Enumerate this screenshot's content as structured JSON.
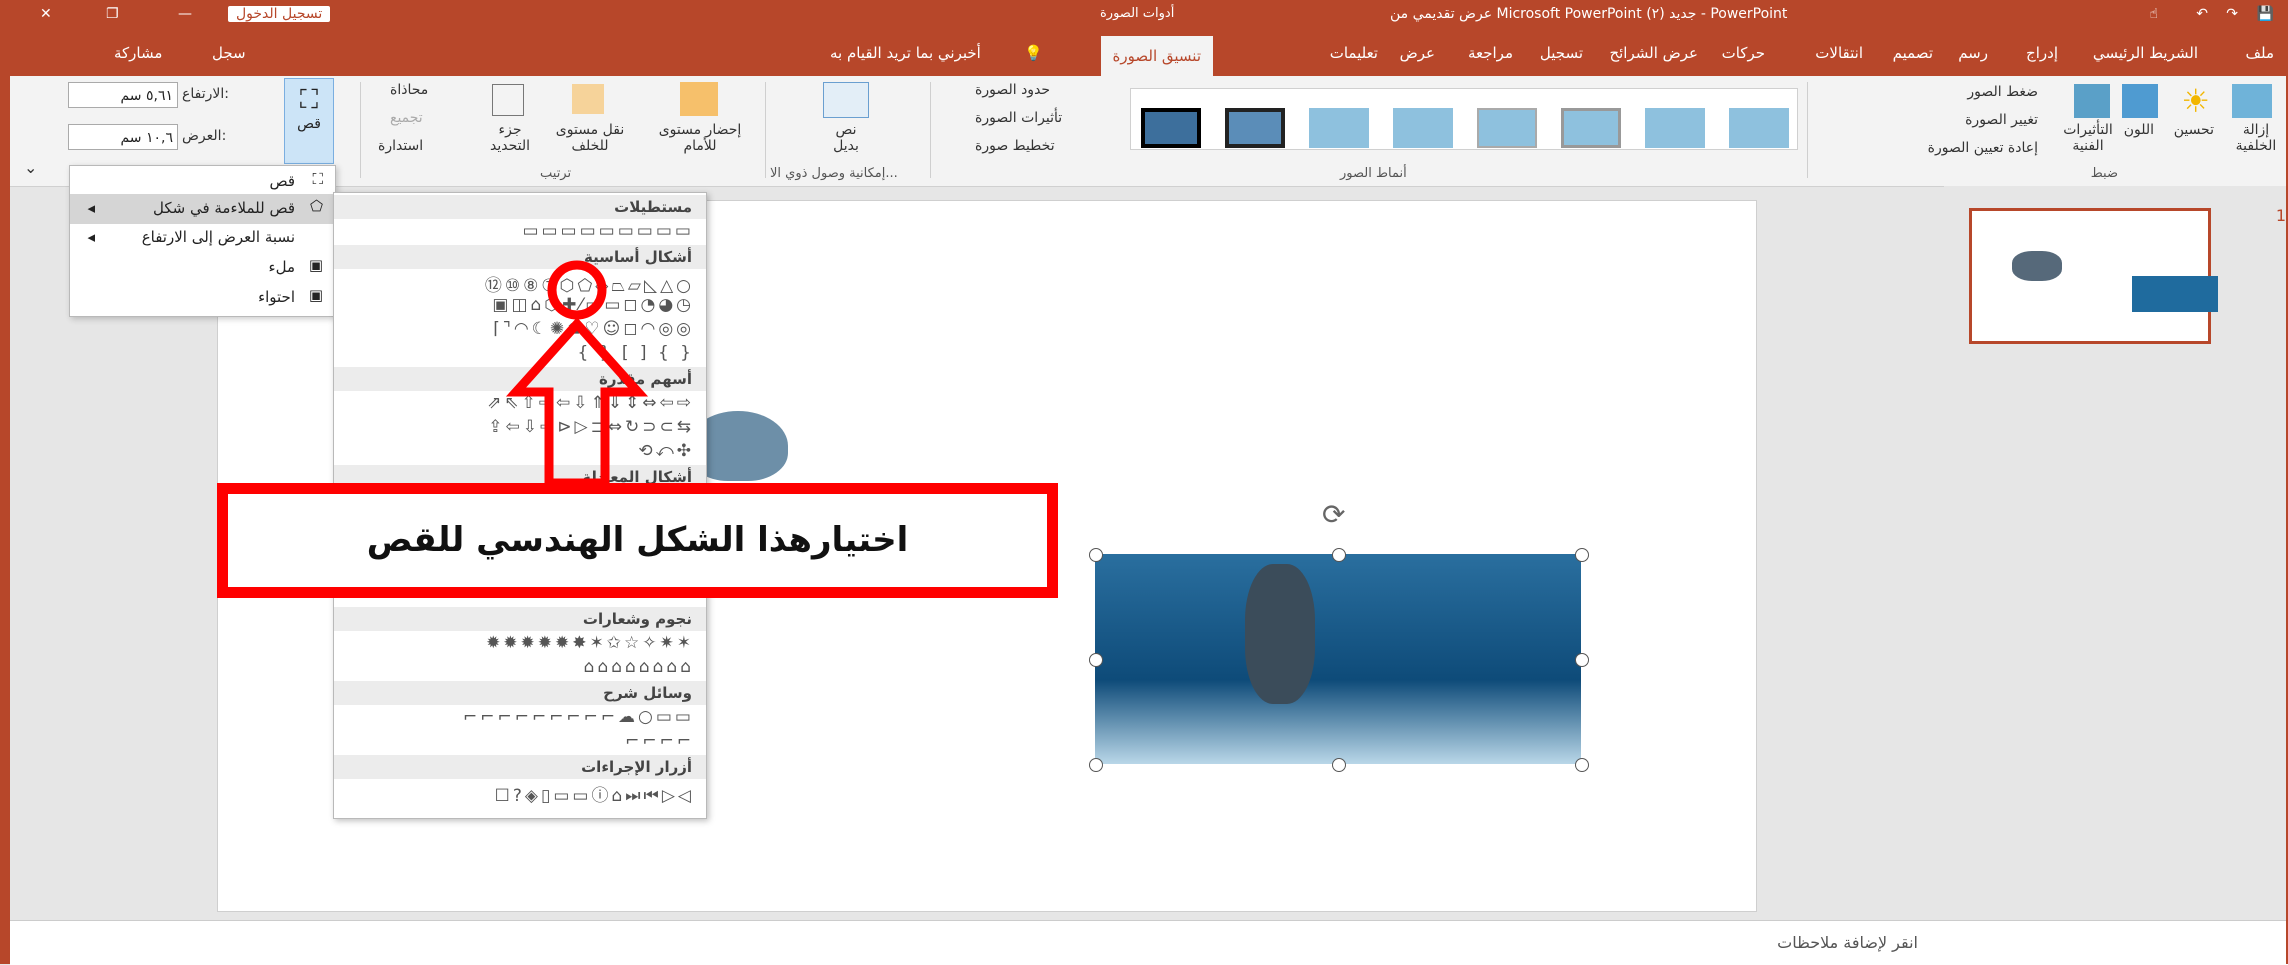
{
  "window": {
    "title": "عرض تقديمي من Microsoft PowerPoint جديد (٢) - PowerPoint",
    "context_tab": "أدوات الصورة",
    "sign_in": "تسجيل الدخول"
  },
  "tabs": [
    "ملف",
    "الشريط الرئيسي",
    "إدراج",
    "رسم",
    "تصميم",
    "انتقالات",
    "حركات",
    "عرض الشرائح",
    "تسجيل",
    "مراجعة",
    "عرض",
    "تعليمات",
    "تنسيق الصورة"
  ],
  "tell_me": "أخبرني بما تريد القيام به",
  "share": "مشاركة",
  "record": "سجل",
  "ribbon": {
    "remove_bg": "إزالة الخلفية",
    "corrections": "تحسين",
    "color": "اللون",
    "artistic": "التأثيرات الفنية",
    "compress": "ضغط الصور",
    "change_pic": "تغيير الصورة",
    "reset_pic": "إعادة تعيين الصورة",
    "adjust_group": "ضبط",
    "styles_group": "أنماط الصور",
    "border": "حدود الصورة",
    "effects": "تأثيرات الصورة",
    "layout": "تخطيط صورة",
    "alt_text": "نص بديل",
    "access_group": "إمكانية وصول ذوي الا...",
    "bring_forward": "إحضار مستوى للأمام",
    "send_backward": "نقل مستوى للخلف",
    "selection_pane": "جزء التحديد",
    "align": "محاذاة",
    "group": "تجميع",
    "rotate": "استدارة",
    "arrange_group": "ترتيب",
    "crop": "قص",
    "height_label": "الارتفاع:",
    "height_value": "٥,٦١ سم",
    "width_label": "العرض:",
    "width_value": "١٠,٦ سم"
  },
  "crop_menu": [
    "قص",
    "قص للملاءمة في شكل",
    "نسبة العرض إلى الارتفاع",
    "ملء",
    "احتواء"
  ],
  "shapes_menu": {
    "headers": [
      "مستطيلات",
      "أشكال أساسية",
      "أسهم مقدرة",
      "أشكال المعادلة",
      "نجوم وشعارات",
      "وسائل شرح",
      "أزرار الإجراءات"
    ]
  },
  "callout_text": "اختيارهذا الشكل الهندسي للقص",
  "slide_number": "1",
  "notes_placeholder": "انقر لإضافة ملاحظات",
  "colors": {
    "accent": "#b7472a",
    "annotation": "#ff0000"
  }
}
